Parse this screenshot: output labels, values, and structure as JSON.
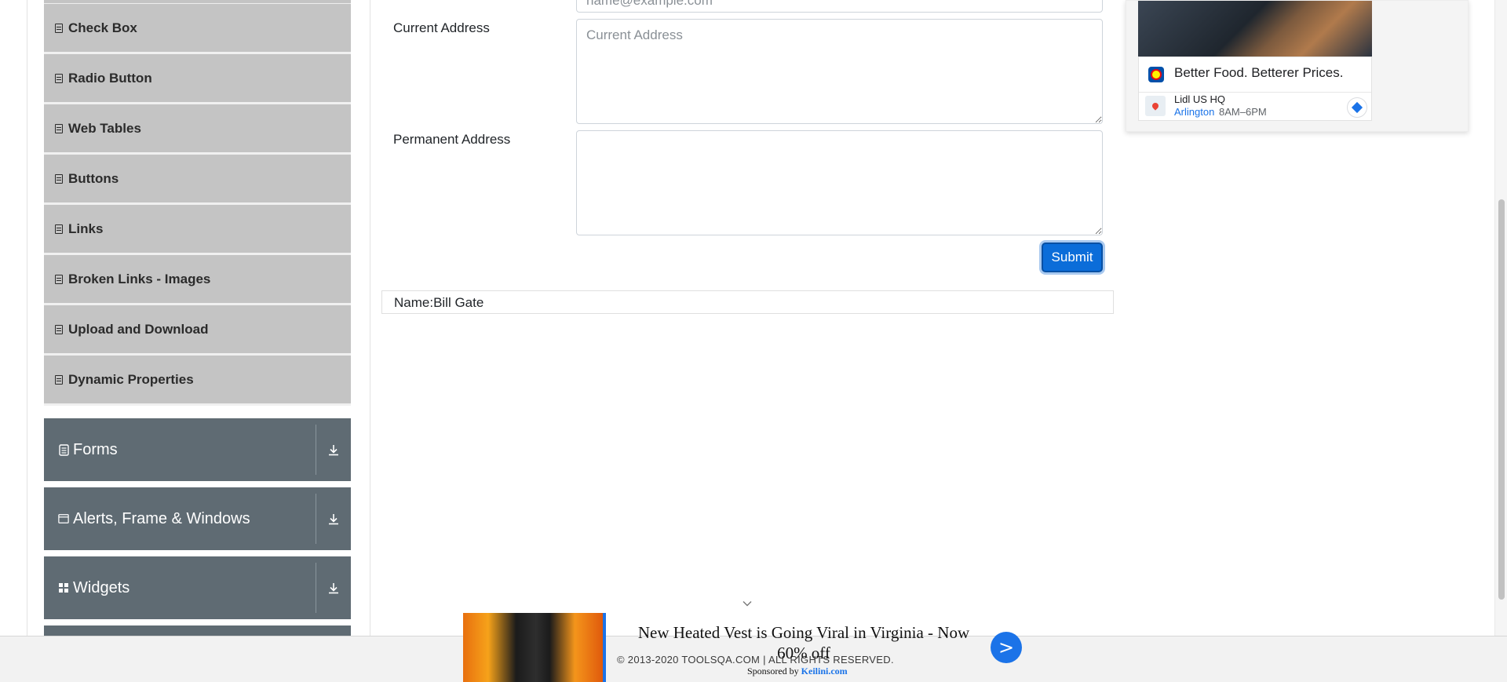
{
  "sidebar": {
    "elements_items": [
      {
        "label": "Check Box",
        "icon": "list-icon"
      },
      {
        "label": "Radio Button",
        "icon": "list-icon"
      },
      {
        "label": "Web Tables",
        "icon": "list-icon"
      },
      {
        "label": "Buttons",
        "icon": "list-icon"
      },
      {
        "label": "Links",
        "icon": "list-icon"
      },
      {
        "label": "Broken Links - Images",
        "icon": "list-icon"
      },
      {
        "label": "Upload and Download",
        "icon": "list-icon"
      },
      {
        "label": "Dynamic Properties",
        "icon": "list-icon"
      }
    ],
    "groups": [
      {
        "label": "Forms",
        "icon": "document-icon"
      },
      {
        "label": "Alerts, Frame & Windows",
        "icon": "window-icon"
      },
      {
        "label": "Widgets",
        "icon": "grid-icon"
      }
    ]
  },
  "form": {
    "email_placeholder": "name@example.com",
    "current_address_label": "Current Address",
    "current_address_placeholder": "Current Address",
    "current_address_value": "",
    "permanent_address_label": "Permanent Address",
    "permanent_address_value": "",
    "submit_label": "Submit",
    "output_name": "Name:Bill Gate"
  },
  "right_ad": {
    "headline": "Better Food. Betterer Prices.",
    "location_name": "Lidl US HQ",
    "location_city": "Arlington",
    "location_hours": "8AM–6PM"
  },
  "bottom_ad": {
    "title": "New Heated Vest is Going Viral in Virginia - Now 60% off",
    "sponsored_prefix": "Sponsored by",
    "sponsor": "Keilini.com",
    "arrow": ">"
  },
  "footer": {
    "copyright": "© 2013-2020 TOOLSQA.COM | ALL RIGHTS RESERVED."
  },
  "colors": {
    "menu_item_bg": "#c4c4c4",
    "group_header_bg": "#5f6b73",
    "submit_bg": "#0b6dd9",
    "ad_accent": "#1b73e8"
  }
}
